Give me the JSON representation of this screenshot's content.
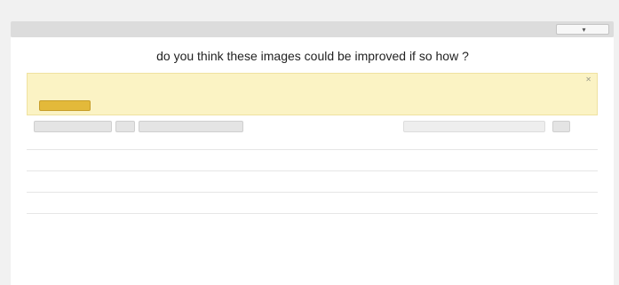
{
  "breadcrumb": {
    "label": ""
  },
  "toolbar": {
    "left_label": "",
    "export_label": "",
    "export_icon": "chevron-down-icon"
  },
  "question": {
    "title": "do you think these images could be improved if so how ?"
  },
  "subnav": {
    "prev_label": "",
    "next_label": ""
  },
  "tabs": [
    {
      "label": "",
      "icon": "list-icon",
      "active": true
    },
    {
      "label": "",
      "icon": "chart-icon",
      "active": false
    },
    {
      "label": "",
      "icon": "tag-icon",
      "active": false
    }
  ],
  "notice": {
    "title": "",
    "body": "",
    "upgrade_label": "",
    "learn_more_label": "",
    "close_icon": "close-icon"
  },
  "filters": {
    "dropdown1": "",
    "dropdown2": "",
    "dropdown3": "",
    "search_placeholder": "",
    "search_button": ""
  },
  "showing_label": "",
  "responses": [
    {
      "text": "",
      "date": "",
      "link": ""
    },
    {
      "text": "",
      "date": "",
      "link": ""
    },
    {
      "text": "",
      "date": "",
      "link": ""
    }
  ],
  "colors": {
    "background": "#f1f1f1",
    "notice_bg": "#fbf3c4",
    "upgrade_btn": "#e3b93a",
    "tab_inactive": "#a9a9a9",
    "link": "#3d7a9e"
  }
}
